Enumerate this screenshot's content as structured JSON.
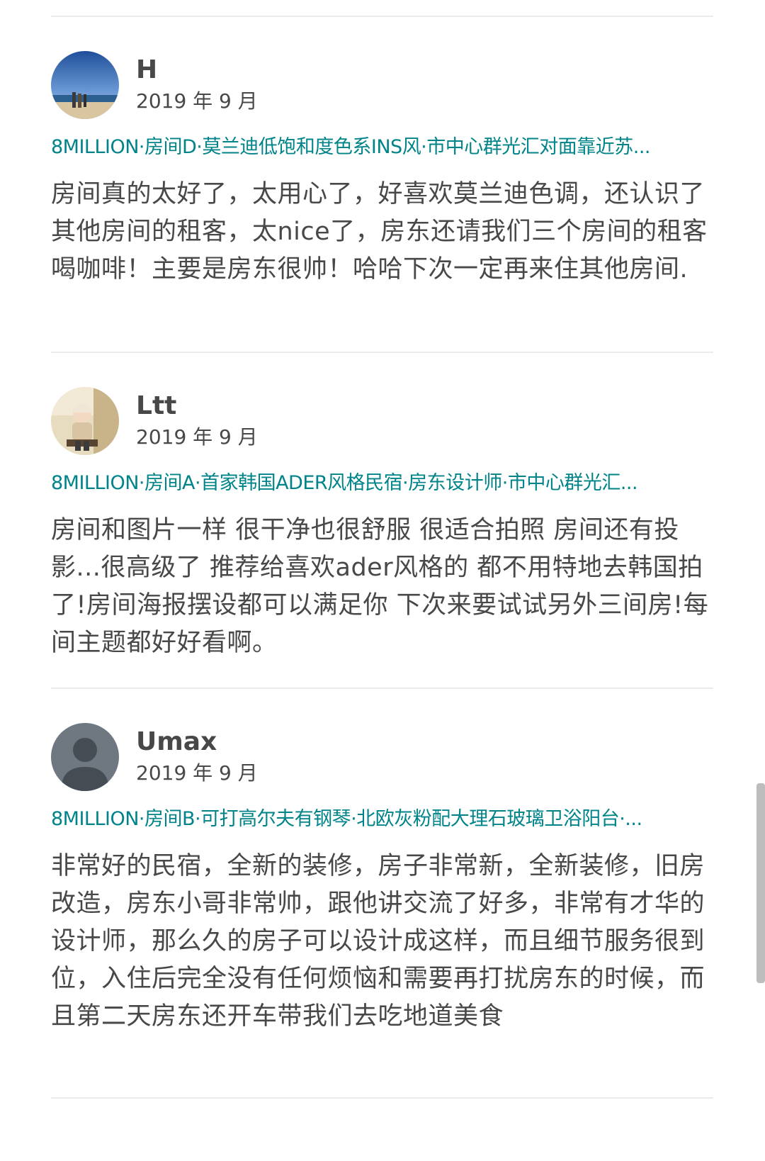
{
  "reviews": [
    {
      "name": "H",
      "date": "2019 年 9 月",
      "listing": "8MILLION·房间D·莫兰迪低饱和度色系INS风·市中心群光汇对面靠近苏...",
      "text": "房间真的太好了，太用心了，好喜欢莫兰迪色调，还认识了其他房间的租客，太nice了，房东还请我们三个房间的租客喝咖啡！主要是房东很帅！哈哈下次一定再来住其他房间."
    },
    {
      "name": "Ltt",
      "date": "2019 年 9 月",
      "listing": "8MILLION·房间A·首家韩国ADER风格民宿·房东设计师·市中心群光汇...",
      "text": "房间和图片一样 很干净也很舒服 很适合拍照 房间还有投影...很高级了 推荐给喜欢ader风格的 都不用特地去韩国拍了!房间海报摆设都可以满足你 下次来要试试另外三间房!每间主题都好好看啊。"
    },
    {
      "name": "Umax",
      "date": "2019 年 9 月",
      "listing": "8MILLION·房间B·可打高尔夫有钢琴·北欧灰粉配大理石玻璃卫浴阳台·...",
      "text": "非常好的民宿，全新的装修，房子非常新，全新装修，旧房改造，房东小哥非常帅，跟他讲交流了好多，非常有才华的设计师，那么久的房子可以设计成这样，而且细节服务很到位，入住后完全没有任何烦恼和需要再打扰房东的时候，而且第二天房东还开车带我们去吃地道美食"
    }
  ],
  "colors": {
    "link": "#008489",
    "text": "#484848",
    "divider": "#ebebeb"
  }
}
